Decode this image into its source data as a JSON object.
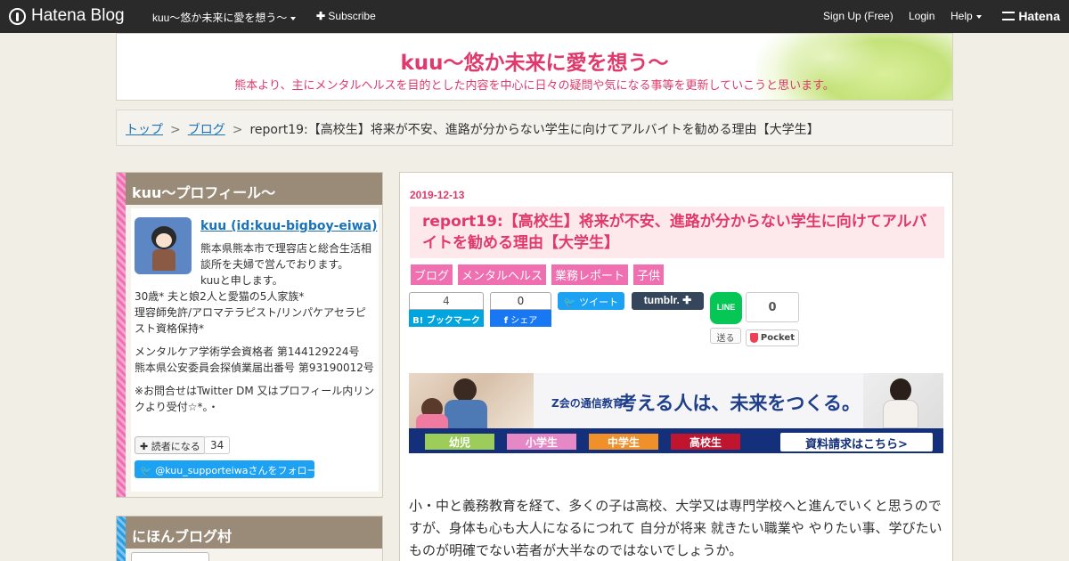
{
  "topbar": {
    "brand": "Hatena Blog",
    "blog_menu": "kuu～悠か未来に愛を想う～",
    "subscribe": "Subscribe",
    "signup": "Sign Up (Free)",
    "login": "Login",
    "help": "Help",
    "hatena": "Hatena"
  },
  "header": {
    "title": "kuu～悠か未来に愛を想う～",
    "description": "熊本より、主にメンタルヘルスを目的とした内容を中心に日々の疑問や気になる事等を更新していこうと思います。"
  },
  "breadcrumb": {
    "top": "トップ",
    "blog": "ブログ",
    "current": "report19:【高校生】将来が不安、進路が分からない学生に向けてアルバイトを勧める理由【大学生】",
    "sep": ">"
  },
  "profile": {
    "heading": "kuu～プロフィール～",
    "name": "kuu (id:kuu-bigboy-eiwa)",
    "line1": "熊本県熊本市で理容店と総合生活相",
    "line2": "談所を夫婦で営んでおります。",
    "line3": "kuuと申します。",
    "line4": "30歳* 夫と娘2人と愛猫の5人家族*",
    "line5": "理容師免許/アロマテラピスト/リンパケアセラピスト資格保持*",
    "line6": "メンタルケア学術学会資格者 第144129224号",
    "line7": "熊本県公安委員会探偵業届出番号 第93190012号",
    "line8": "※お問合せはTwitter DM 又はプロフィール内リンクより受付☆*。・",
    "reader_button": "読者になる",
    "reader_count": "34",
    "follow_button": "@kuu_supporteiwaさんをフォロー"
  },
  "village": {
    "heading": "にほんブログ村"
  },
  "article": {
    "date": "2019-12-13",
    "title": "report19:【高校生】将来が不安、進路が分からない学生に向けてアルバイトを勧める理由【大学生】",
    "categories": [
      "ブログ",
      "メンタルヘルス",
      "業務レポート",
      "子供"
    ],
    "share": {
      "hatena_count": "4",
      "hatena_label": "B! ブックマーク",
      "facebook_count": "0",
      "facebook_label": "シェア",
      "tweet_label": "ツイート",
      "tumblr_label": "tumblr.",
      "line_label": "LINE",
      "line_send": "送る",
      "pocket_count": "0",
      "pocket_label": "Pocket"
    },
    "ad": {
      "brand": "Z会の通信教育",
      "slogan": "考える人は、未来をつくる。",
      "tags": [
        "幼児",
        "小学生",
        "中学生",
        "高校生"
      ],
      "tag_colors": [
        "#9ccc5a",
        "#e687c6",
        "#f0902a",
        "#c0152f"
      ],
      "cta": "資料請求はこちら>"
    },
    "body": "小・中と義務教育を経て、多くの子は高校、大学又は専門学校へと進んでいくと思うのですが、身体も心も大人になるにつれて 自分が将来 就きたい職業や やりたい事、学びたいものが明確でない若者が大半なのではないでしょうか。"
  },
  "colors": {
    "accent": "#e0396b",
    "category": "#ef6fb0",
    "profile_stripe": "#ef6fb0",
    "village_stripe": "#2b9fe0",
    "sidebar_head": "#9a8b78"
  }
}
